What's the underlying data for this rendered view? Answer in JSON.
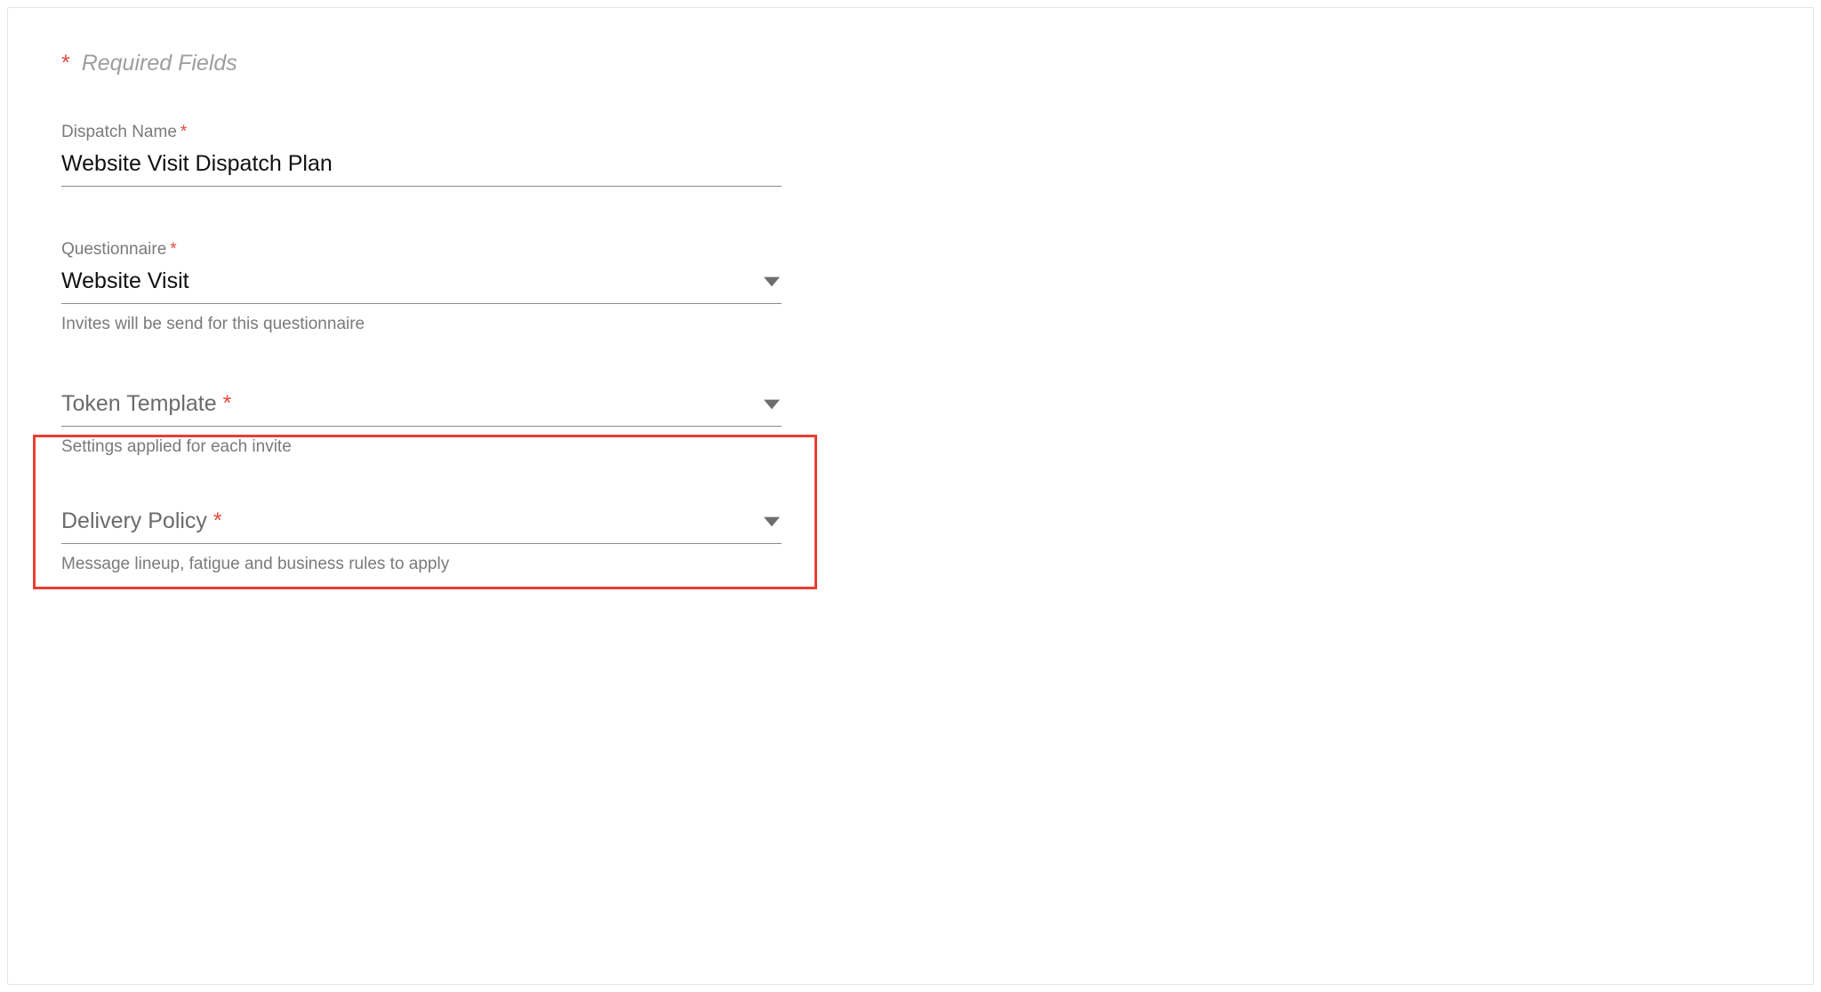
{
  "required_label": "Required Fields",
  "fields": {
    "dispatch_name": {
      "label": "Dispatch Name",
      "value": "Website Visit Dispatch Plan"
    },
    "questionnaire": {
      "label": "Questionnaire",
      "value": "Website Visit",
      "helper": "Invites will be send for this questionnaire"
    },
    "token_template": {
      "label": "Token Template",
      "value": "",
      "helper": "Settings applied for each invite"
    },
    "delivery_policy": {
      "label": "Delivery Policy",
      "value": "",
      "helper": "Message lineup, fatigue and business rules to apply"
    }
  },
  "asterisk": "*"
}
